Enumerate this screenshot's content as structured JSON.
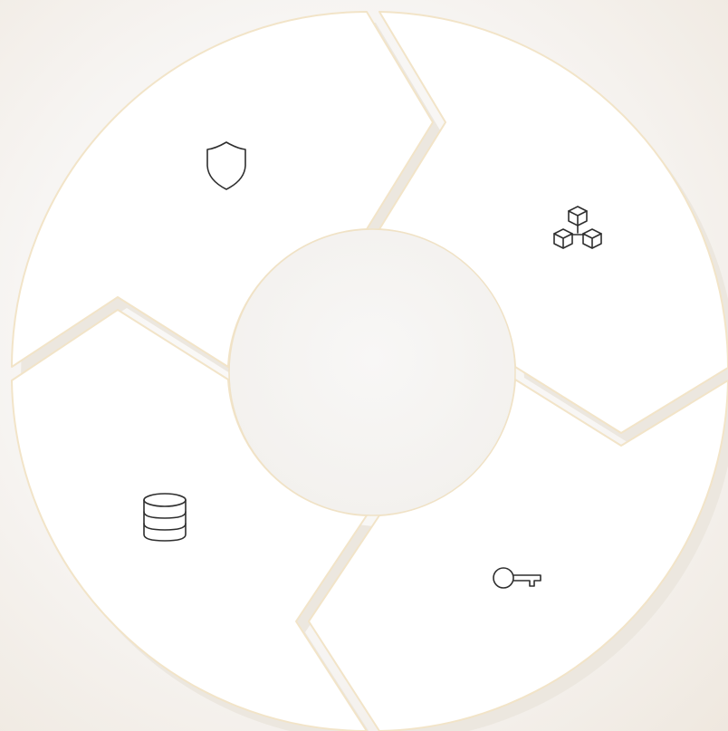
{
  "diagram": {
    "type": "cycle",
    "center_label": "",
    "segments": [
      {
        "id": "security",
        "icon": "shield-icon",
        "label": ""
      },
      {
        "id": "blockchain",
        "icon": "blocks-network-icon",
        "label": ""
      },
      {
        "id": "access",
        "icon": "key-icon",
        "label": ""
      },
      {
        "id": "storage",
        "icon": "database-icon",
        "label": ""
      }
    ]
  },
  "colors": {
    "segment_fill": "#ffffff",
    "segment_outline": "#f2e4c8",
    "icon_stroke": "#2e2e2e",
    "background": "#f7f5f3"
  }
}
